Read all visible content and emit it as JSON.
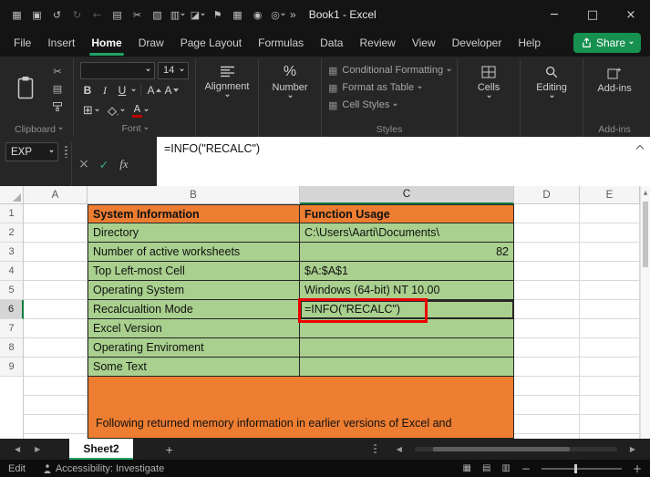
{
  "titlebar": {
    "title": "Book1 - Excel",
    "overflow": "»",
    "qat": [
      {
        "name": "ribbon-options-icon",
        "glyph": "▦"
      },
      {
        "name": "save-icon",
        "glyph": "▣"
      },
      {
        "name": "undo-icon",
        "glyph": "↺"
      },
      {
        "name": "redo-icon",
        "glyph": "↻",
        "disabled": true
      },
      {
        "name": "back-icon",
        "glyph": "←",
        "disabled": true
      },
      {
        "name": "copy-icon",
        "glyph": "▤"
      },
      {
        "name": "cut-icon",
        "glyph": "✂"
      },
      {
        "name": "picture-icon",
        "glyph": "▧"
      },
      {
        "name": "print-preview-icon",
        "glyph": "▥",
        "chevron": true
      },
      {
        "name": "format-painter-icon",
        "glyph": "◪",
        "chevron": true
      },
      {
        "name": "flag-icon",
        "glyph": "⚑"
      },
      {
        "name": "insert-table-icon",
        "glyph": "▦"
      },
      {
        "name": "camera-icon",
        "glyph": "◉"
      },
      {
        "name": "search-icon",
        "glyph": "◎",
        "chevron": true
      }
    ],
    "window": {
      "minimize": "─",
      "maximize": "□",
      "close": "×"
    }
  },
  "ribbon": {
    "tabs": [
      "File",
      "Insert",
      "Home",
      "Draw",
      "Page Layout",
      "Formulas",
      "Data",
      "Review",
      "View",
      "Developer",
      "Help"
    ],
    "active_tab": "Home",
    "share": {
      "label": "Share"
    },
    "groups": {
      "clipboard": "Clipboard",
      "font": "Font",
      "alignment": "Alignment",
      "number": "Number",
      "styles": "Styles",
      "cells": "Cells",
      "editing": "Editing",
      "addins": "Add-ins"
    },
    "styles_items": [
      "Conditional Formatting",
      "Format as Table",
      "Cell Styles"
    ],
    "font": {
      "name": "",
      "size": "14",
      "bold": "B",
      "italic": "I",
      "underline": "U",
      "grow": "A",
      "shrink": "A",
      "color_letter": "A"
    },
    "number_glyph": "%"
  },
  "icons": {
    "cut": "✂",
    "copy": "▤",
    "borders": "⊞",
    "styles_grid": "▦"
  },
  "formula_bar": {
    "name_box": "EXP",
    "cancel": "×",
    "enter": "✓",
    "fx": "fx",
    "formula": "=INFO(\"RECALC\")"
  },
  "grid": {
    "columns": [
      "A",
      "B",
      "C",
      "D",
      "E"
    ],
    "active_column": "C",
    "active_cell": "C6",
    "rows": [
      {
        "num": "1",
        "B": "System Information",
        "C": "Function Usage",
        "fill": "orange"
      },
      {
        "num": "2",
        "B": "Directory",
        "C": "C:\\Users\\Aarti\\Documents\\",
        "fill": "green"
      },
      {
        "num": "3",
        "B": "Number of active worksheets",
        "C": "82",
        "fill": "green",
        "c_align": "right"
      },
      {
        "num": "4",
        "B": "Top Left-most Cell",
        "C": "$A:$A$1",
        "fill": "green"
      },
      {
        "num": "5",
        "B": "Operating System",
        "C": "Windows (64-bit) NT 10.00",
        "fill": "green"
      },
      {
        "num": "6",
        "B": "Recalcualtion Mode",
        "C": "=INFO(\"RECALC\")",
        "fill": "green",
        "active": true
      },
      {
        "num": "7",
        "B": "Excel Version",
        "C": "",
        "fill": "green"
      },
      {
        "num": "8",
        "B": "Operating Enviroment",
        "C": "",
        "fill": "green"
      },
      {
        "num": "9",
        "B": "Some Text",
        "C": "",
        "fill": "green"
      }
    ],
    "banner": "Following returned memory information in earlier versions of Excel and"
  },
  "sheet_bar": {
    "tabs": [
      {
        "label": "Sheet2",
        "active": true
      }
    ],
    "new_sheet": "+",
    "nav_left": "◀",
    "nav_right": "▶"
  },
  "status_bar": {
    "mode": "Edit",
    "accessibility": "Accessibility: Investigate",
    "view_icons": [
      "▦",
      "▤",
      "▥"
    ],
    "zoom_out": "−",
    "zoom_in": "+"
  },
  "colors": {
    "accent_green": "#21a366",
    "share_green": "#179150",
    "header_orange": "#ED7D31",
    "cell_green": "#A9D08E",
    "highlight_red": "#ec0000"
  }
}
